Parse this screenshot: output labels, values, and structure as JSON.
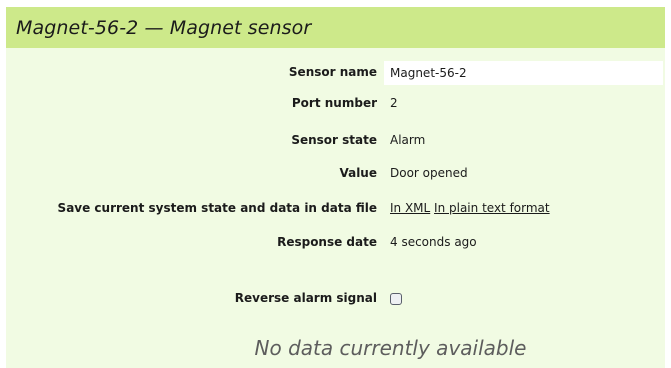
{
  "header": {
    "title": "Magnet-56-2 — Magnet sensor"
  },
  "fields": {
    "sensor_name": {
      "label": "Sensor name",
      "value": "Magnet-56-2"
    },
    "port_number": {
      "label": "Port number",
      "value": "2"
    },
    "sensor_state": {
      "label": "Sensor state",
      "value": "Alarm"
    },
    "value": {
      "label": "Value",
      "value": "Door opened"
    },
    "save_state": {
      "label": "Save current system state and data in data file",
      "link_xml": "In XML",
      "link_text": "In plain text format"
    },
    "response_date": {
      "label": "Response date",
      "value": "4 seconds ago"
    },
    "reverse_alarm": {
      "label": "Reverse alarm signal",
      "checked": false
    }
  },
  "footer": {
    "no_data": "No data currently available"
  },
  "colors": {
    "header_bg": "#cde98a",
    "panel_bg": "#f1fbe3"
  }
}
